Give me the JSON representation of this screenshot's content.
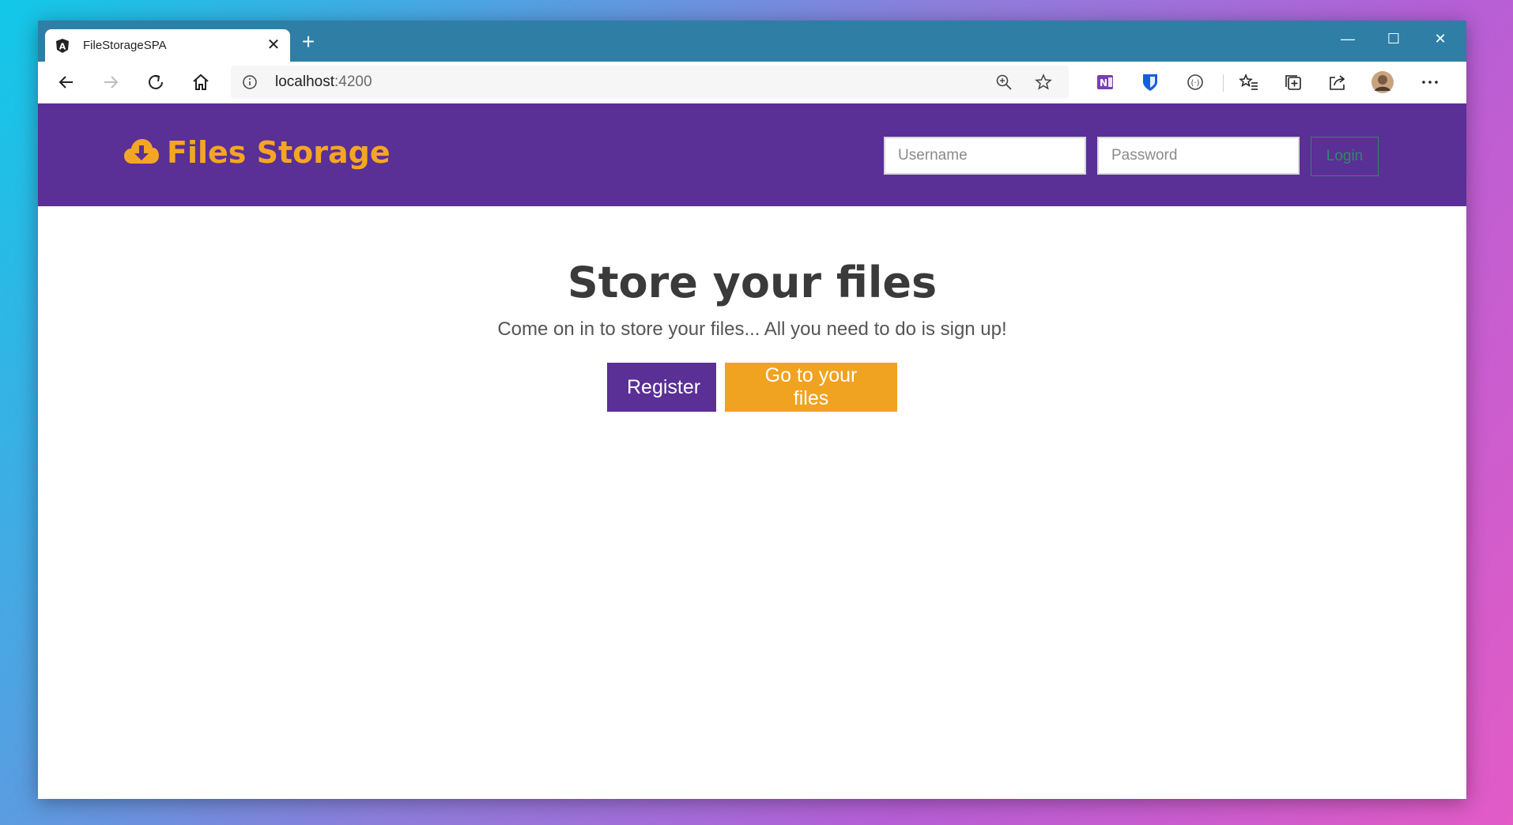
{
  "browser": {
    "tab_title": "FileStorageSPA",
    "close_tab": "✕",
    "new_tab": "+",
    "url_host": "localhost",
    "url_port": ":4200",
    "window_controls": {
      "minimize": "—",
      "maximize": "☐",
      "close": "✕"
    },
    "toolbar_icons": [
      "back-icon",
      "forward-icon",
      "refresh-icon",
      "home-icon",
      "info-icon",
      "zoom-icon",
      "favorite-star-icon",
      "onenote-icon",
      "bitwarden-icon",
      "extension-icon",
      "favorites-icon",
      "collections-icon",
      "share-icon",
      "profile-avatar",
      "more-icon"
    ]
  },
  "header": {
    "brand_text": "Files Storage",
    "username_placeholder": "Username",
    "password_placeholder": "Password",
    "login_label": "Login"
  },
  "main": {
    "title": "Store your files",
    "subtitle": "Come on in to store your files... All you need to do is sign up!",
    "register_label": "Register",
    "files_label": "Go to your files"
  },
  "colors": {
    "header_bg": "#5a2f96",
    "brand": "#f5a524",
    "register_bg": "#5a2f96",
    "files_bg": "#f0a320",
    "login_border": "#2f8a6a",
    "tabbar_bg": "#2e7ea6"
  }
}
